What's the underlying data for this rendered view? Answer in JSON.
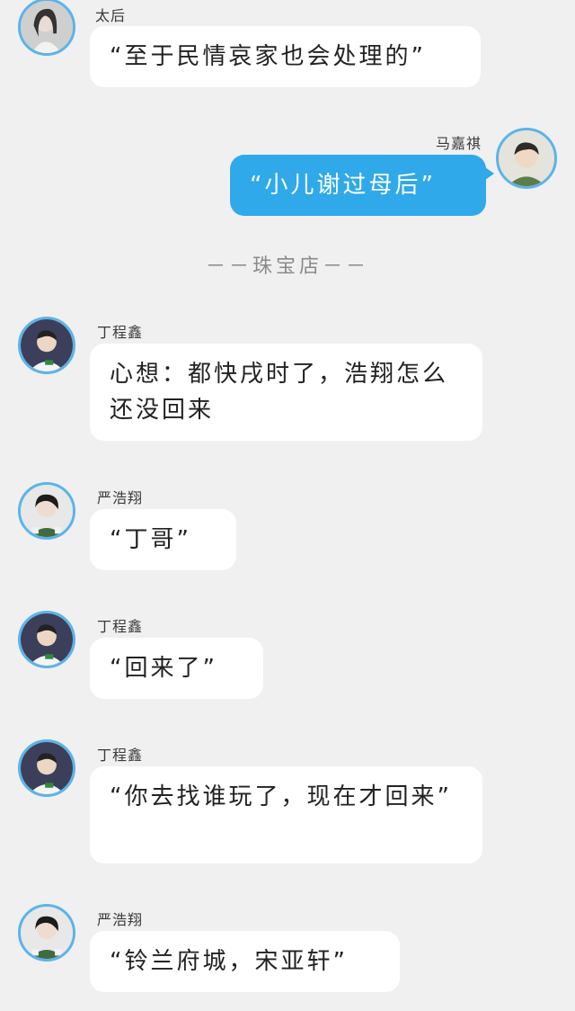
{
  "colors": {
    "background": "#f0f0f0",
    "bubble": "#ffffff",
    "self_bubble": "#2fa9ea",
    "avatar_ring": "#5bb4ea"
  },
  "messages": [
    {
      "sender": "太后",
      "text": "“至于民情哀家也会处理的”",
      "side": "left"
    },
    {
      "sender": "马嘉祺",
      "text": "“小儿谢过母后”",
      "side": "right"
    },
    {
      "sender": "丁程鑫",
      "text": "心想：都快戌时了，浩翔怎么还没回来",
      "side": "left"
    },
    {
      "sender": "严浩翔",
      "text": "“丁哥”",
      "side": "left"
    },
    {
      "sender": "丁程鑫",
      "text": "“回来了”",
      "side": "left"
    },
    {
      "sender": "丁程鑫",
      "text": "“你去找谁玩了，现在才回来”",
      "side": "left"
    },
    {
      "sender": "严浩翔",
      "text": "“铃兰府城，宋亚轩”",
      "side": "left"
    }
  ],
  "divider": "－－珠宝店－－"
}
